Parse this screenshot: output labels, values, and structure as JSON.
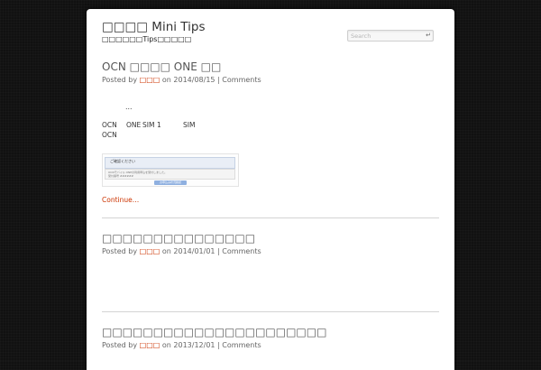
{
  "site": {
    "title": "□□□□ Mini Tips",
    "description": "□□□□□□Tips□□□□□"
  },
  "search": {
    "placeholder": "Search",
    "submit_icon": "enter-arrow-icon",
    "submit_glyph": "↵"
  },
  "posts": [
    {
      "title": "OCN □□□□ ONE □□",
      "meta": {
        "posted_by": "Posted by",
        "author": "□□□",
        "on": "on",
        "date": "2014/08/15",
        "sep": "|",
        "comments": "Comments"
      },
      "excerpt": {
        "ellipsis": "…",
        "line1": [
          "OCN",
          "ONE",
          "SIM",
          "1",
          "SIM"
        ],
        "line2": "OCN"
      },
      "screenshot": {
        "heading": "ご確認ください",
        "lines": [
          "OCNモバイル ONEの利用申込を受付しました。",
          "受付番号 ######"
        ],
        "button": "お申込み状況確認"
      },
      "continue_label": "Continue…"
    },
    {
      "title": "□□□□□□□□□□□□□□□",
      "meta": {
        "posted_by": "Posted by",
        "author": "□□□",
        "on": "on",
        "date": "2014/01/01",
        "sep": "|",
        "comments": "Comments"
      }
    },
    {
      "title": "□□□□□□□□□□□□□□□□□□□□□□",
      "meta": {
        "posted_by": "Posted by",
        "author": "□□□",
        "on": "on",
        "date": "2013/12/01",
        "sep": "|",
        "comments": "Comments"
      }
    }
  ],
  "colors": {
    "background": "#111111",
    "page": "#ffffff",
    "link_accent": "#cc3300",
    "title_text": "#555555"
  }
}
